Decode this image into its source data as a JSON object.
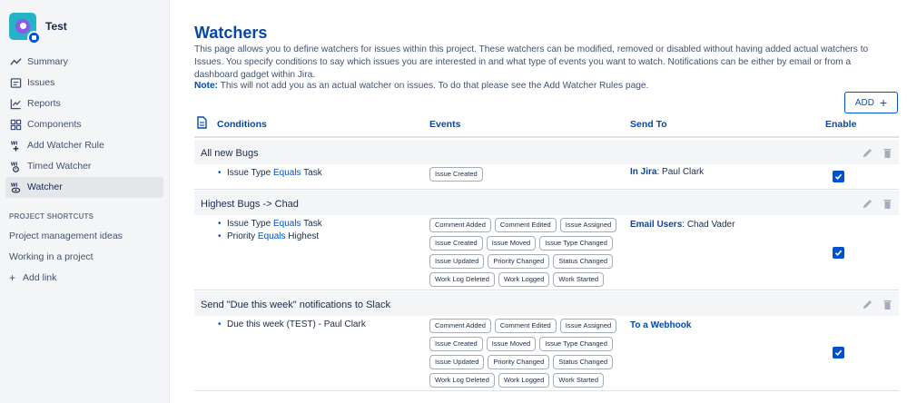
{
  "project": {
    "name": "Test"
  },
  "sidebar": {
    "items": [
      {
        "label": "Summary",
        "icon": "summary-icon"
      },
      {
        "label": "Issues",
        "icon": "issues-icon"
      },
      {
        "label": "Reports",
        "icon": "reports-icon"
      },
      {
        "label": "Components",
        "icon": "components-icon"
      },
      {
        "label": "Add Watcher Rule",
        "icon": "add-watcher-rule-icon"
      },
      {
        "label": "Timed Watcher",
        "icon": "timed-watcher-icon"
      },
      {
        "label": "Watcher",
        "icon": "watcher-icon",
        "active": true
      }
    ],
    "shortcuts_header": "PROJECT SHORTCUTS",
    "shortcuts": [
      "Project management ideas",
      "Working in a project"
    ],
    "add_link": "Add link"
  },
  "page": {
    "title": "Watchers",
    "description": "This page allows you to define watchers for issues within this project. These watchers can be modified, removed or disabled without having added actual watchers to Issues. You specify conditions to say which issues you are interested in and what type of events you want to watch. Notifications can be either by email or from a dashboard gadget within Jira.",
    "note_label": "Note:",
    "note_text": " This will not add you as an actual watcher on issues. To do that please see the Add Watcher Rules page.",
    "add_button": "ADD"
  },
  "table": {
    "headers": {
      "conditions": "Conditions",
      "events": "Events",
      "send_to": "Send To",
      "enable": "Enable"
    },
    "rows": [
      {
        "title": "All new Bugs",
        "conditions": [
          {
            "field": "Issue Type",
            "op": "Equals",
            "value": "Task"
          }
        ],
        "events": [
          "Issue Created"
        ],
        "send_to_key": "In Jira",
        "send_to_val": ": Paul Clark",
        "enabled": true
      },
      {
        "title": "Highest Bugs -> Chad",
        "conditions": [
          {
            "field": "Issue Type",
            "op": "Equals",
            "value": "Task"
          },
          {
            "field": "Priority",
            "op": "Equals",
            "value": "Highest"
          }
        ],
        "events": [
          "Comment Added",
          "Comment Edited",
          "Issue Assigned",
          "Issue Created",
          "Issue Moved",
          "Issue Type Changed",
          "Issue Updated",
          "Priority Changed",
          "Status Changed",
          "Work Log Deleted",
          "Work Logged",
          "Work Started"
        ],
        "send_to_key": "Email Users",
        "send_to_val": ": Chad Vader",
        "enabled": true
      },
      {
        "title": "Send \"Due this week\" notifications to Slack",
        "conditions": [
          {
            "text": "Due this week (TEST) - Paul Clark"
          }
        ],
        "events": [
          "Comment Added",
          "Comment Edited",
          "Issue Assigned",
          "Issue Created",
          "Issue Moved",
          "Issue Type Changed",
          "Issue Updated",
          "Priority Changed",
          "Status Changed",
          "Work Log Deleted",
          "Work Logged",
          "Work Started"
        ],
        "send_to_key": "To a Webhook",
        "send_to_val": "",
        "enabled": true
      }
    ]
  },
  "colors": {
    "accent": "#0052cc",
    "title": "#0747a6",
    "sidebar_bg": "#f4f5f7"
  }
}
